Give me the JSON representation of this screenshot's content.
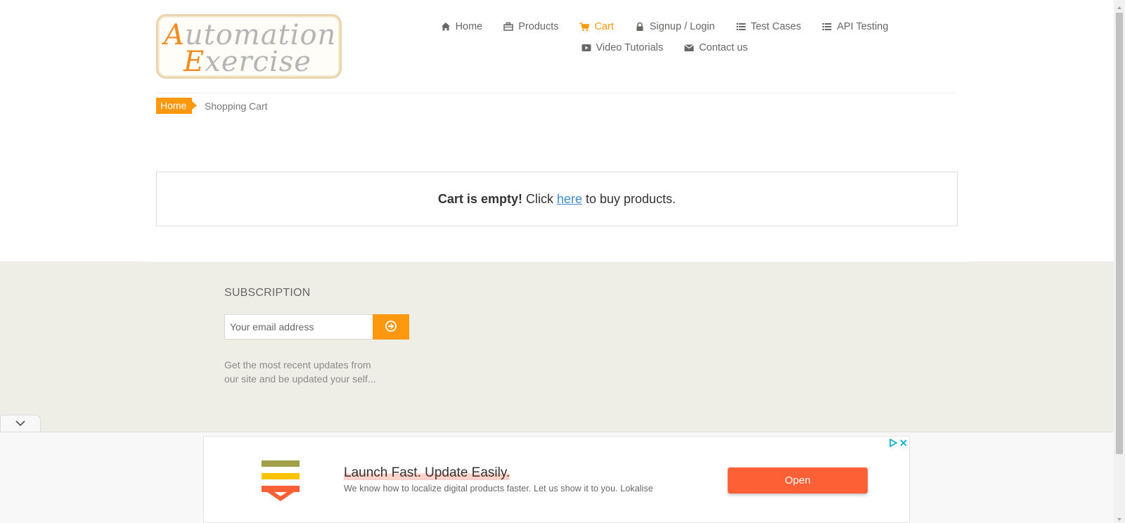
{
  "logo": {
    "line1_cap": "A",
    "line1_rest": "utomation",
    "line2_cap": "E",
    "line2_rest": "xercise"
  },
  "nav": {
    "row1": [
      {
        "label": "Home",
        "icon": "home-icon"
      },
      {
        "label": "Products",
        "icon": "products-icon"
      },
      {
        "label": "Cart",
        "icon": "cart-icon",
        "active": true
      },
      {
        "label": "Signup / Login",
        "icon": "lock-icon"
      },
      {
        "label": "Test Cases",
        "icon": "list-icon"
      },
      {
        "label": "API Testing",
        "icon": "list-icon"
      }
    ],
    "row2": [
      {
        "label": "Video Tutorials",
        "icon": "youtube-icon"
      },
      {
        "label": "Contact us",
        "icon": "envelope-icon"
      }
    ]
  },
  "breadcrumb": {
    "home": "Home",
    "current": "Shopping Cart"
  },
  "cart": {
    "empty_bold": "Cart is empty!",
    "click": "Click",
    "link": "here",
    "after": "to buy products."
  },
  "footer": {
    "subscription_title": "SUBSCRIPTION",
    "email_placeholder": "Your email address",
    "description": "Get the most recent updates from our site and be updated your self..."
  },
  "ad": {
    "title": "Launch Fast. Update Easily.",
    "description": "We know how to localize digital products faster. Let us show it to you. Lokalise",
    "button": "Open"
  },
  "colors": {
    "accent": "#fe980f",
    "ad_button": "#fe6036",
    "footer_bg": "#eeede6",
    "link": "#428bca"
  }
}
